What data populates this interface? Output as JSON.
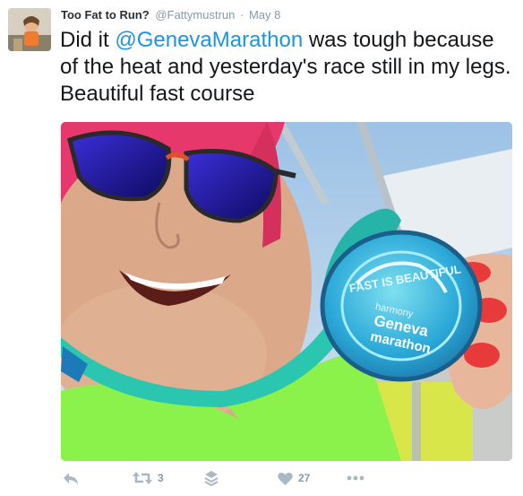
{
  "tweet": {
    "display_name": "Too Fat to Run?",
    "handle": "@Fattymustrun",
    "separator": "·",
    "date": "May 8",
    "text_before": "Did it ",
    "mention": "@GenevaMarathon",
    "text_after": " was tough because of the heat and yesterday's race still in my legs. Beautiful fast course",
    "medal_text": {
      "top": "FAST IS BEAUTIFUL",
      "brand": "harmony",
      "line1": "Geneva",
      "line2": "marathon"
    }
  },
  "actions": {
    "retweet_count": "3",
    "like_count": "27"
  },
  "colors": {
    "link": "#1b95e0",
    "icon": "#aab8c2",
    "meta": "#8899a6",
    "shirt": "#8af24a",
    "headband": "#e6386a",
    "ribbon": "#2bc6b0",
    "medal": "#2aa8d8"
  }
}
